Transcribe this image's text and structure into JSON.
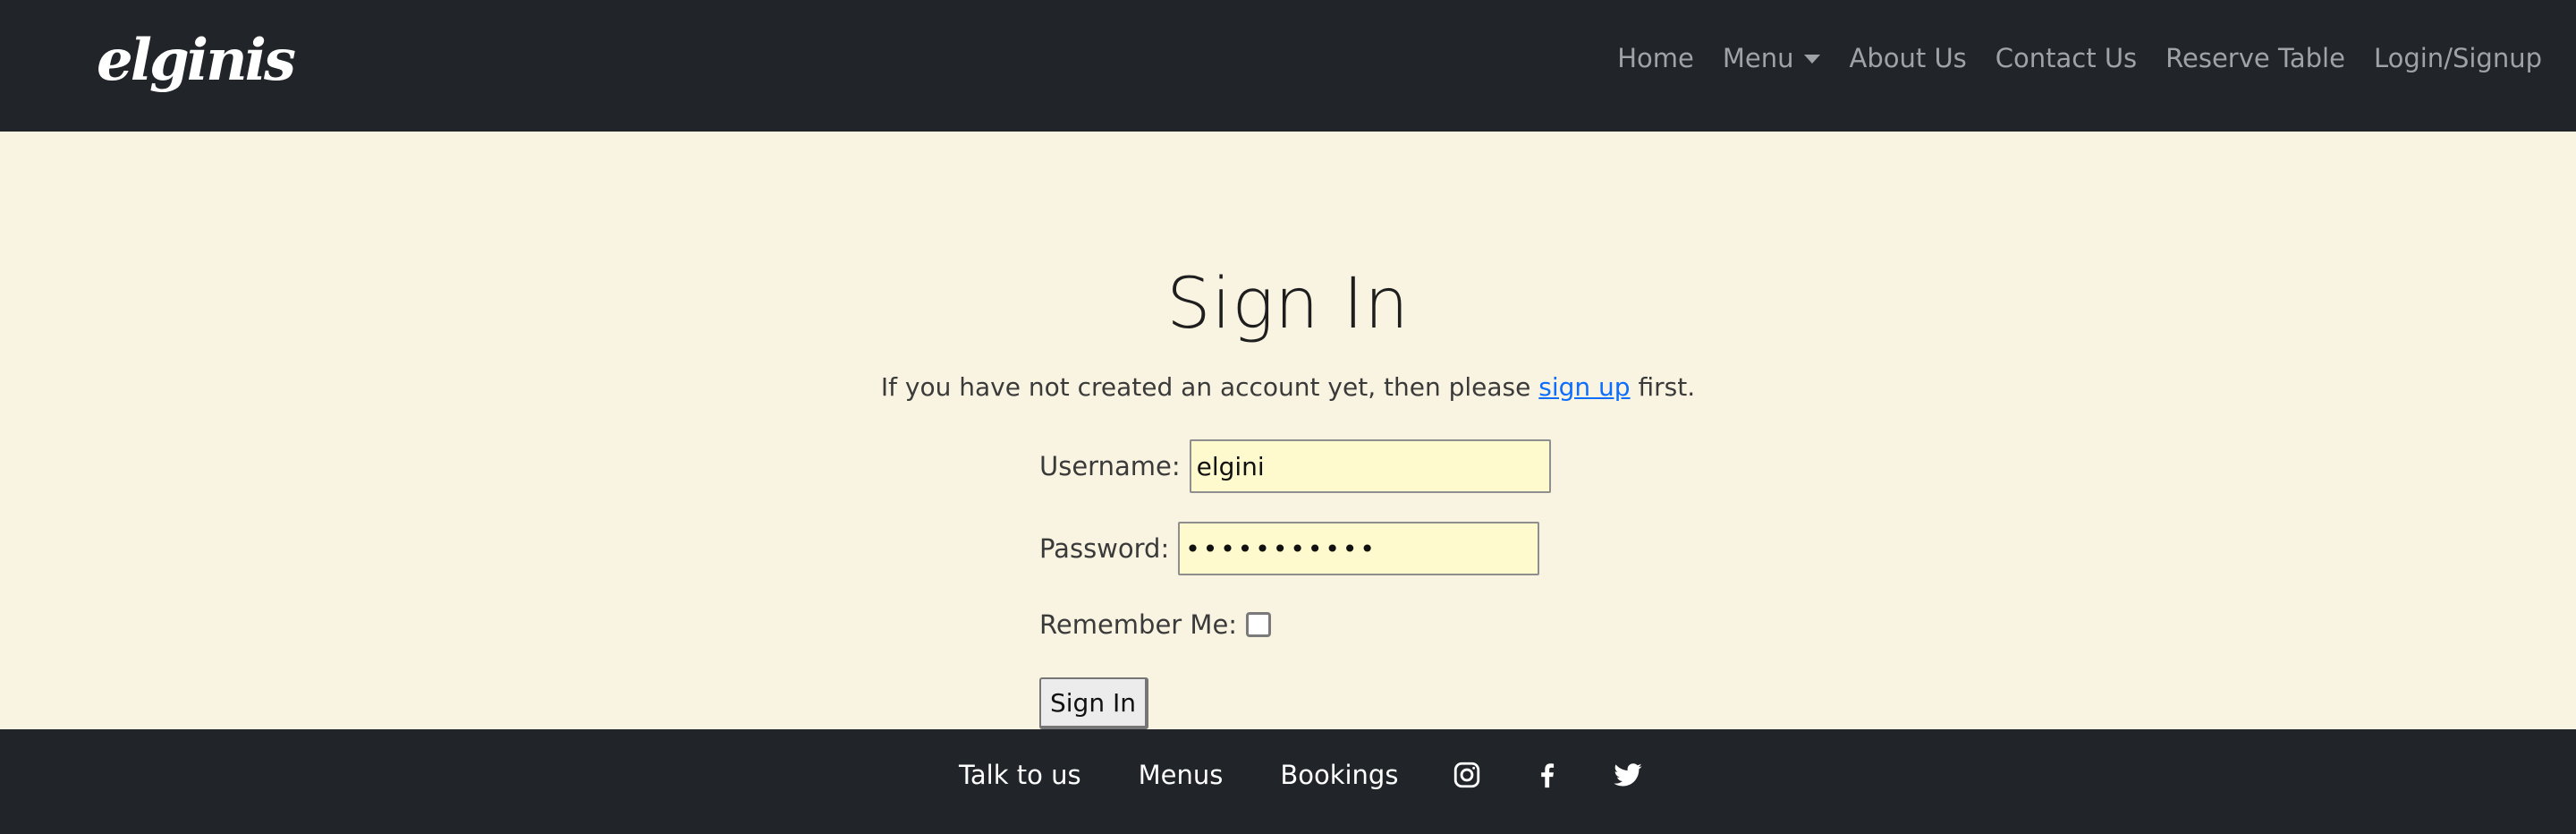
{
  "navbar": {
    "brand": "elginis",
    "links": [
      {
        "label": "Home"
      },
      {
        "label": "Menu"
      },
      {
        "label": "About Us"
      },
      {
        "label": "Contact Us"
      },
      {
        "label": "Reserve Table"
      },
      {
        "label": "Login/Signup"
      }
    ]
  },
  "page": {
    "title": "Sign In",
    "intro_before": "If you have not created an account yet, then please",
    "intro_link": "sign up",
    "intro_after": "first."
  },
  "form": {
    "username_label": "Username:",
    "username_value": "elgini",
    "password_label": "Password:",
    "password_value": "elginielgin",
    "remember_label": "Remember Me:",
    "remember_checked": false,
    "submit_label": "Sign In"
  },
  "footer": {
    "links": [
      {
        "label": "Talk to us"
      },
      {
        "label": "Menus"
      },
      {
        "label": "Bookings"
      }
    ],
    "social_icons": [
      "instagram-icon",
      "facebook-icon",
      "twitter-icon"
    ]
  },
  "colors": {
    "navbar_bg": "#212529",
    "page_bg": "#f9f4e1",
    "link_blue": "#0d6efd",
    "input_bg": "#fffacd"
  }
}
